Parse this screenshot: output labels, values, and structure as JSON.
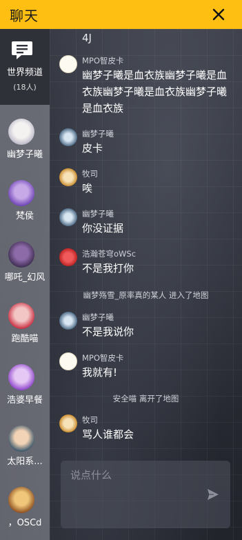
{
  "header": {
    "title": "聊天"
  },
  "sidebar": {
    "world": {
      "label": "世界频道",
      "count": "(18人)"
    },
    "items": [
      {
        "name": "幽梦子曦"
      },
      {
        "name": "梵侯"
      },
      {
        "name": "哪吒_幻风"
      },
      {
        "name": "跑酷喵"
      },
      {
        "name": "浩婆早餐"
      },
      {
        "name": "太阳系..."
      },
      {
        "name": "，OSCd"
      }
    ]
  },
  "messages": [
    {
      "sender": "",
      "text": "4J"
    },
    {
      "sender": "MPO智皮卡",
      "text": "幽梦子曦是血衣族幽梦子曦是血衣族幽梦子曦是血衣族幽梦子曦是血衣族"
    },
    {
      "sender": "幽梦子曦",
      "text": "皮卡"
    },
    {
      "sender": "牧司",
      "text": "唉"
    },
    {
      "sender": "幽梦子曦",
      "text": "你没证据"
    },
    {
      "sender": "浩瀚苍穹oWSc",
      "text": "不是我打你"
    },
    {
      "sender": "幽梦子曦",
      "text": "不是我说你"
    },
    {
      "sender": "MPO智皮卡",
      "text": "我就有!"
    },
    {
      "sender": "牧司",
      "text": "骂人谁都会"
    }
  ],
  "system": [
    "幽梦殇雪_原率真的某人 进入了地图",
    "安全喵 离开了地图"
  ],
  "input": {
    "placeholder": "说点什么"
  },
  "colors": {
    "accent": "#ffbf12"
  }
}
